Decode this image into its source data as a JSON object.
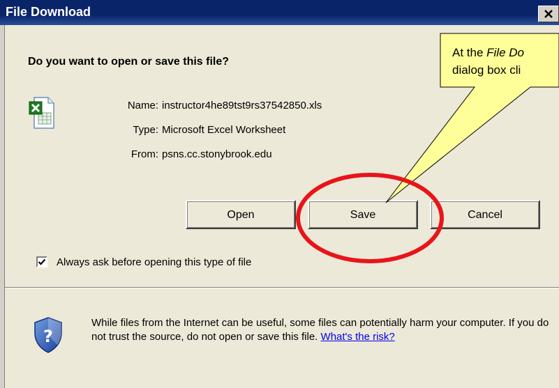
{
  "window": {
    "title": "File Download",
    "close_label": "✕"
  },
  "dialog": {
    "question": "Do you want to open or save this file?",
    "name_label": "Name:",
    "name_value": "instructor4he89tst9rs37542850.xls",
    "type_label": "Type:",
    "type_value": "Microsoft Excel Worksheet",
    "from_label": "From:",
    "from_value": "psns.cc.stonybrook.edu",
    "buttons": {
      "open": "Open",
      "save": "Save",
      "cancel": "Cancel"
    },
    "checkbox": {
      "label": "Always ask before opening this type of file",
      "checked": true
    },
    "warning": {
      "text": "While files from the Internet can be useful, some files can potentially harm your computer. If you do not trust the source, do not open or save this file.",
      "link": "What's the risk?"
    }
  },
  "callout": {
    "line1_prefix": "At the ",
    "line1_em": "File Do",
    "line2": "dialog box cli"
  },
  "colors": {
    "titlebar": "#0a246a",
    "dialog_bg": "#ece9d8",
    "callout_fill": "#ffff99",
    "highlight_circle": "#e8141a",
    "link": "#0000ee"
  },
  "icons": [
    "excel-file-icon",
    "security-shield-icon",
    "close-icon",
    "checkmark-icon"
  ]
}
